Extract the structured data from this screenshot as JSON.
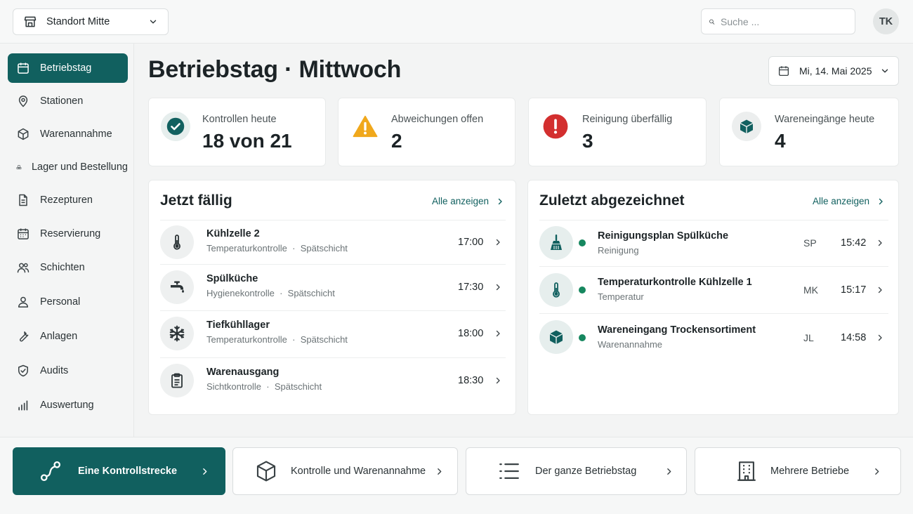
{
  "header": {
    "location": "Standort Mitte",
    "search_placeholder": "Suche ...",
    "avatar": "TK"
  },
  "sidebar": {
    "items": [
      {
        "label": "Betriebstag",
        "icon": "calendar-icon",
        "active": true
      },
      {
        "label": "Stationen",
        "icon": "map-pin-icon"
      },
      {
        "label": "Warenannahme",
        "icon": "box-icon"
      },
      {
        "label": "Lager und Bestellung",
        "icon": "stack-boxes-icon"
      },
      {
        "label": "Rezepturen",
        "icon": "document-icon"
      },
      {
        "label": "Reservierung",
        "icon": "calendar-grid-icon"
      },
      {
        "label": "Schichten",
        "icon": "users-icon"
      },
      {
        "label": "Personal",
        "icon": "user-icon"
      },
      {
        "label": "Anlagen",
        "icon": "wrench-icon"
      },
      {
        "label": "Audits",
        "icon": "shield-check-icon"
      },
      {
        "label": "Auswertung",
        "icon": "bar-chart-icon"
      }
    ]
  },
  "main": {
    "title": "Betriebstag · Mittwoch",
    "date": "Mi, 14. Mai 2025",
    "stats": [
      {
        "label": "Kontrollen heute",
        "value": "18 von 21",
        "icon": "check-circle-icon",
        "color": "#11605f"
      },
      {
        "label": "Abweichungen offen",
        "value": "2",
        "icon": "warning-triangle-icon",
        "color": "#f0a81c"
      },
      {
        "label": "Reinigung überfällig",
        "value": "3",
        "icon": "alert-circle-icon",
        "color": "#d32f2f"
      },
      {
        "label": "Wareneingänge heute",
        "value": "4",
        "icon": "package-icon",
        "color": "#11605f"
      }
    ],
    "due": {
      "title": "Jetzt fällig",
      "link": "Alle anzeigen",
      "items": [
        {
          "title": "Kühlzelle 2",
          "type": "Temperaturkontrolle",
          "shift": "Spätschicht",
          "time": "17:00",
          "icon": "thermometer-icon"
        },
        {
          "title": "Spülküche",
          "type": "Hygienekontrolle",
          "shift": "Spätschicht",
          "time": "17:30",
          "icon": "faucet-icon"
        },
        {
          "title": "Tiefkühllager",
          "type": "Temperaturkontrolle",
          "shift": "Spätschicht",
          "time": "18:00",
          "icon": "snowflake-icon"
        },
        {
          "title": "Warenausgang",
          "type": "Sichtkontrolle",
          "shift": "Spätschicht",
          "time": "18:30",
          "icon": "clipboard-icon"
        }
      ],
      "separator": "·"
    },
    "signed": {
      "title": "Zuletzt abgezeichnet",
      "link": "Alle anzeigen",
      "items": [
        {
          "title": "Reinigungsplan Spülküche",
          "sub": "Reinigung",
          "initials": "SP",
          "time": "15:42",
          "icon": "broom-icon"
        },
        {
          "title": "Temperaturkontrolle Kühlzelle 1",
          "sub": "Temperatur",
          "initials": "MK",
          "time": "15:17",
          "icon": "thermometer-icon"
        },
        {
          "title": "Wareneingang Trockensortiment",
          "sub": "Warenannahme",
          "initials": "JL",
          "time": "14:58",
          "icon": "package-icon"
        }
      ]
    }
  },
  "modes": [
    {
      "label": "Eine Kontrollstrecke",
      "icon": "route-icon",
      "active": true
    },
    {
      "label": "Kontrolle und Warenannahme",
      "icon": "box-outline-icon"
    },
    {
      "label": "Der ganze Betriebstag",
      "icon": "list-icon"
    },
    {
      "label": "Mehrere Betriebe",
      "icon": "building-icon"
    }
  ],
  "colors": {
    "accent": "#11605f",
    "status_ok": "#16875f",
    "warning": "#f0a81c",
    "danger": "#d32f2f"
  }
}
